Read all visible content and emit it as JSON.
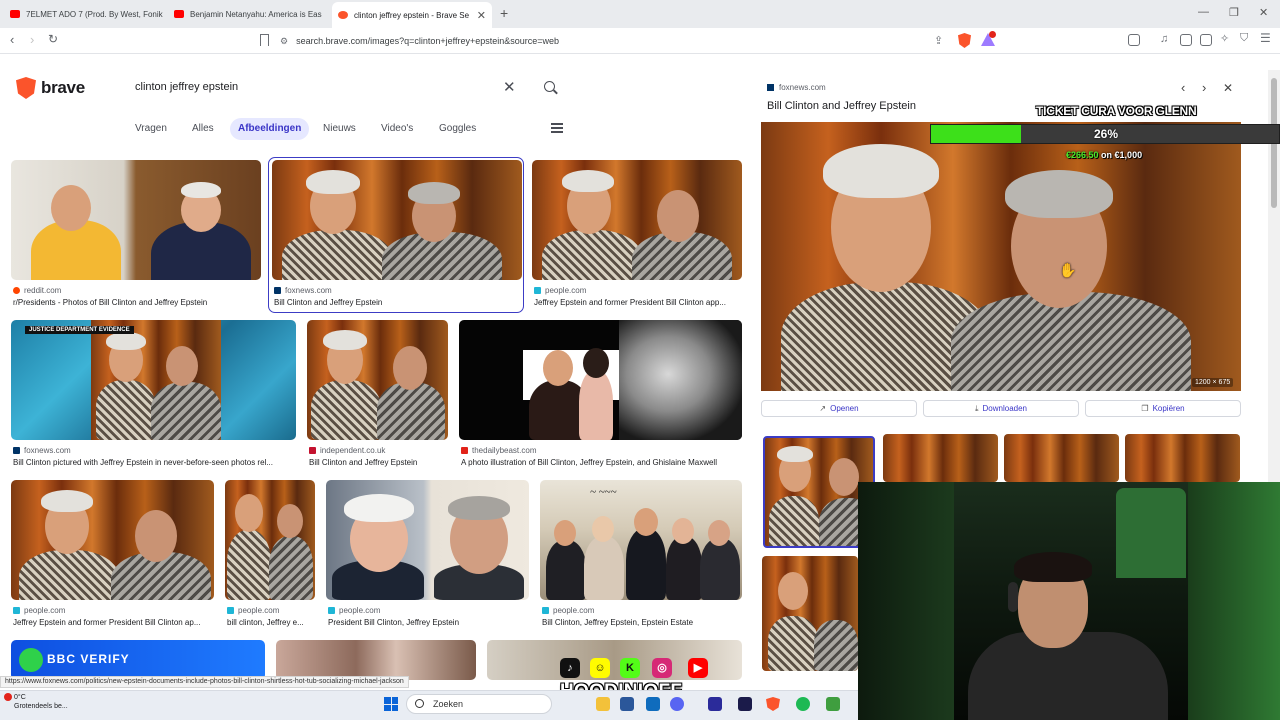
{
  "browser": {
    "tabs": [
      {
        "title": "7ELMET ADO 7 (Prod. By West, Fonik",
        "favicon_color": "#ff0000",
        "active": false
      },
      {
        "title": "Benjamin Netanyahu: America is Eas",
        "favicon_color": "#ff0000",
        "active": false
      },
      {
        "title": "clinton jeffrey epstein - Brave Se",
        "favicon_color": "#fb542b",
        "active": true
      }
    ],
    "new_tab": "+",
    "url": "search.brave.com/images?q=clinton+jeffrey+epstein&source=web"
  },
  "search": {
    "logo": "brave",
    "query": "clinton jeffrey epstein",
    "tabs": [
      "Vragen",
      "Alles",
      "Afbeeldingen",
      "Nieuws",
      "Video's",
      "Goggles"
    ],
    "active_tab": "Afbeeldingen"
  },
  "results": [
    {
      "source": "reddit.com",
      "caption": "r/Presidents - Photos of Bill Clinton and Jeffrey Epstein",
      "fav": "#ff4500"
    },
    {
      "source": "foxnews.com",
      "caption": "Bill Clinton and Jeffrey Epstein",
      "fav": "#003366"
    },
    {
      "source": "people.com",
      "caption": "Jeffrey Epstein and former President Bill Clinton app...",
      "fav": "#1fb6d6"
    },
    {
      "source": "foxnews.com",
      "caption": "Bill Clinton pictured with Jeffrey Epstein in never-before-seen photos rel...",
      "fav": "#003366",
      "badge": "JUSTICE DEPARTMENT EVIDENCE"
    },
    {
      "source": "independent.co.uk",
      "caption": "Bill Clinton and Jeffrey Epstein",
      "fav": "#c4122f"
    },
    {
      "source": "thedailybeast.com",
      "caption": "A photo illustration of Bill Clinton, Jeffrey Epstein, and Ghislaine Maxwell",
      "fav": "#e2231a"
    },
    {
      "source": "people.com",
      "caption": "Jeffrey Epstein and former President Bill Clinton ap...",
      "fav": "#1fb6d6"
    },
    {
      "source": "people.com",
      "caption": "bill clinton, Jeffrey e...",
      "fav": "#1fb6d6"
    },
    {
      "source": "people.com",
      "caption": "President Bill Clinton, Jeffrey Epstein",
      "fav": "#1fb6d6"
    },
    {
      "source": "people.com",
      "caption": "Bill Clinton, Jeffrey Epstein, Epstein Estate",
      "fav": "#1fb6d6"
    }
  ],
  "preview": {
    "source": "foxnews.com",
    "title": "Bill Clinton and Jeffrey Epstein",
    "dimensions": "1200 × 675",
    "buttons": {
      "open": "Openen",
      "download": "Downloaden",
      "copy": "Kopiëren"
    }
  },
  "overlay": {
    "goal_title": "TICKET CURA VOOR GLENN",
    "goal_percent": "26%",
    "goal_progress": 0.26,
    "goal_raised": "€266.50",
    "goal_sep": " on ",
    "goal_target": "€1,000",
    "bbc_label": "BBC VERIFY",
    "brand": "HOODINIOFF"
  },
  "status_url": "https://www.foxnews.com/politics/new-epstein-documents-include-photos-bill-clinton-shirtless-hot-tub-socializing-michael-jackson",
  "taskbar": {
    "temperature": "0°C",
    "weather": "Grotendeels be...",
    "search_placeholder": "Zoeken"
  }
}
